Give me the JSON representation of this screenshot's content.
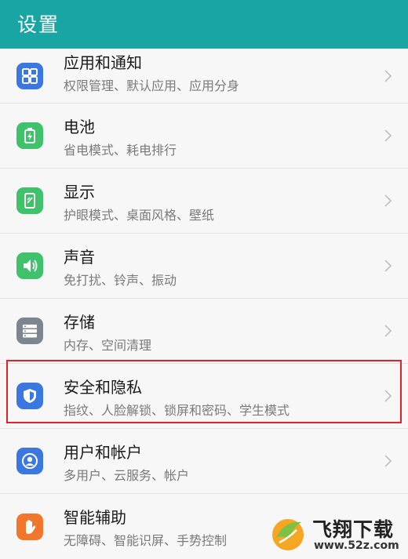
{
  "header": {
    "title": "设置"
  },
  "items": [
    {
      "title": "应用和通知",
      "subtitle": "权限管理、默认应用、应用分身",
      "icon": "apps-grid-icon",
      "color": "#3a77e0"
    },
    {
      "title": "电池",
      "subtitle": "省电模式、耗电排行",
      "icon": "battery-icon",
      "color": "#3fc26b"
    },
    {
      "title": "显示",
      "subtitle": "护眼模式、桌面风格、壁纸",
      "icon": "display-icon",
      "color": "#3fc26b"
    },
    {
      "title": "声音",
      "subtitle": "免打扰、铃声、振动",
      "icon": "speaker-icon",
      "color": "#3fc26b"
    },
    {
      "title": "存储",
      "subtitle": "内存、空间清理",
      "icon": "storage-icon",
      "color": "#7d8590"
    },
    {
      "title": "安全和隐私",
      "subtitle": "指纹、人脸解锁、锁屏和密码、学生模式",
      "icon": "shield-icon",
      "color": "#3a77e0"
    },
    {
      "title": "用户和帐户",
      "subtitle": "多用户、云服务、帐户",
      "icon": "user-icon",
      "color": "#3a77e0"
    },
    {
      "title": "智能辅助",
      "subtitle": "无障碍、智能识屏、手势控制",
      "icon": "hand-icon",
      "color": "#f2762b"
    }
  ],
  "highlight": {
    "color": "#e0232a"
  },
  "watermark": {
    "name": "飞翔下载",
    "url": "www.52z.com"
  },
  "colors": {
    "header": "#1aa5a5"
  }
}
